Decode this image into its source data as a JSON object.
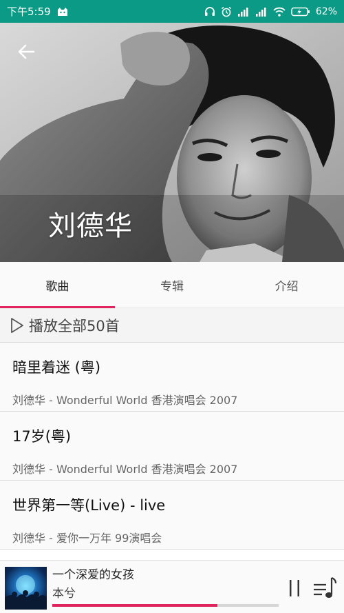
{
  "status_bar": {
    "time": "下午5:59",
    "battery": "62%",
    "icons": [
      "notification-cat-icon",
      "headphones-icon",
      "alarm-icon",
      "signal-icon",
      "signal-icon",
      "wifi-icon",
      "battery-charging-icon"
    ],
    "background": "#0b9a86"
  },
  "header": {
    "back_icon": "back-arrow-icon",
    "artist_name": "刘德华"
  },
  "tabs": [
    {
      "label": "歌曲",
      "active": true
    },
    {
      "label": "专辑",
      "active": false
    },
    {
      "label": "介绍",
      "active": false
    }
  ],
  "play_all": {
    "icon": "play-outline-icon",
    "label": "播放全部50首"
  },
  "songs": [
    {
      "title": "暗里着迷 (粤)",
      "subtitle": "刘德华 - Wonderful World 香港演唱会 2007"
    },
    {
      "title": "17岁(粤)",
      "subtitle": "刘德华 - Wonderful World 香港演唱会 2007"
    },
    {
      "title": "世界第一等(Live) - live",
      "subtitle": "刘德华 - 爱你一万年 99演唱会"
    }
  ],
  "now_playing": {
    "title": "一个深爱的女孩",
    "artist": "本兮",
    "progress": 0.73,
    "pause_icon": "pause-icon",
    "playlist_icon": "playlist-icon"
  },
  "colors": {
    "accent": "#e0245e",
    "status_bar": "#0b9a86"
  }
}
